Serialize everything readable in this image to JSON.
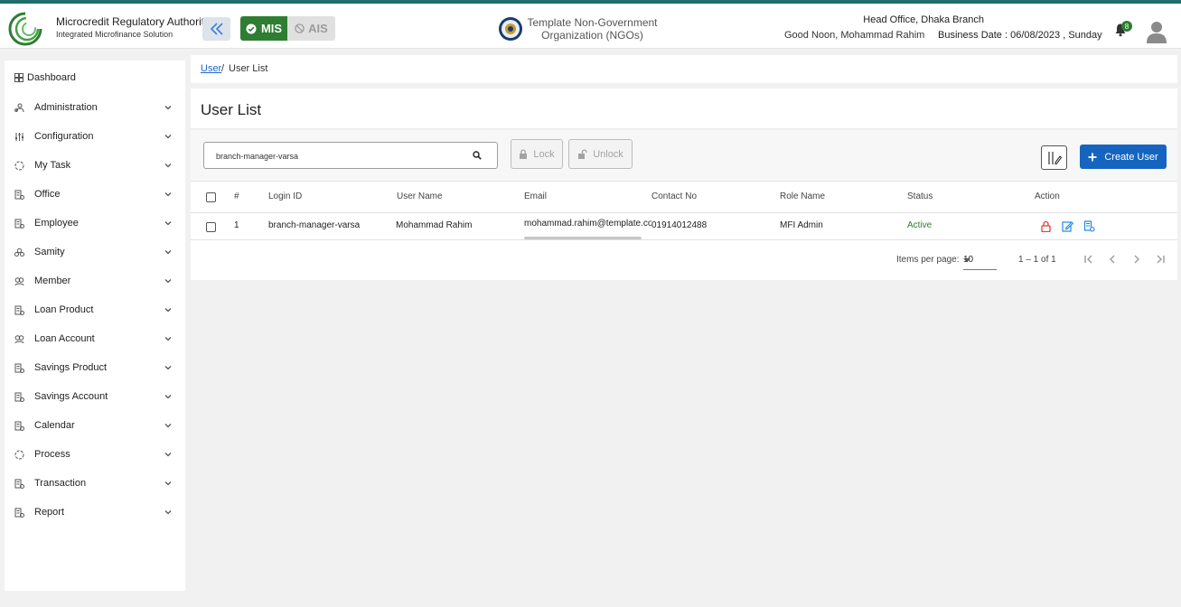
{
  "header": {
    "org_name": "Microcredit Regulatory Authority",
    "org_sub": "Integrated Microfinance Solution",
    "mis_label": "MIS",
    "ais_label": "AIS",
    "ngo_line1": "Template Non-Government",
    "ngo_line2": "Organization (NGOs)",
    "greeting": "Good Noon, Mohammad Rahim",
    "branch": "Head Office, Dhaka Branch",
    "business_date": "Business Date : 06/08/2023 , Sunday",
    "notification_count": "8"
  },
  "sidebar": {
    "dashboard": "Dashboard",
    "items": [
      {
        "label": "Administration",
        "icon": "users-icon"
      },
      {
        "label": "Configuration",
        "icon": "sliders-icon"
      },
      {
        "label": "My Task",
        "icon": "task-icon"
      },
      {
        "label": "Office",
        "icon": "office-icon"
      },
      {
        "label": "Employee",
        "icon": "employee-icon"
      },
      {
        "label": "Samity",
        "icon": "samity-icon"
      },
      {
        "label": "Member",
        "icon": "member-icon"
      },
      {
        "label": "Loan Product",
        "icon": "loan-product-icon"
      },
      {
        "label": "Loan Account",
        "icon": "loan-account-icon"
      },
      {
        "label": "Savings Product",
        "icon": "savings-product-icon"
      },
      {
        "label": "Savings Account",
        "icon": "savings-account-icon"
      },
      {
        "label": "Calendar",
        "icon": "calendar-icon"
      },
      {
        "label": "Process",
        "icon": "process-icon"
      },
      {
        "label": "Transaction",
        "icon": "transaction-icon"
      },
      {
        "label": "Report",
        "icon": "report-icon"
      }
    ]
  },
  "breadcrumb": {
    "link": "User",
    "separator": "/",
    "current": "User List"
  },
  "page": {
    "title": "User List"
  },
  "toolbar": {
    "search_value": "branch-manager-varsa",
    "lock_label": "Lock",
    "unlock_label": "Unlock",
    "create_label": "Create User"
  },
  "table": {
    "headers": [
      "#",
      "Login ID",
      "User Name",
      "Email",
      "Contact No",
      "Role Name",
      "Status",
      "Action"
    ],
    "rows": [
      {
        "index": "1",
        "login_id": "branch-manager-varsa",
        "user_name": "Mohammad Rahim",
        "email": "mohammad.rahim@template.com",
        "contact": "01914012488",
        "role": "MFI Admin",
        "status": "Active"
      }
    ]
  },
  "paginator": {
    "items_per_page_label": "Items per page:",
    "items_per_page": "10",
    "range": "1 – 1 of 1"
  },
  "colors": {
    "brand_green": "#2e7d32",
    "primary_blue": "#1565c0",
    "lock_red": "#e53935"
  }
}
